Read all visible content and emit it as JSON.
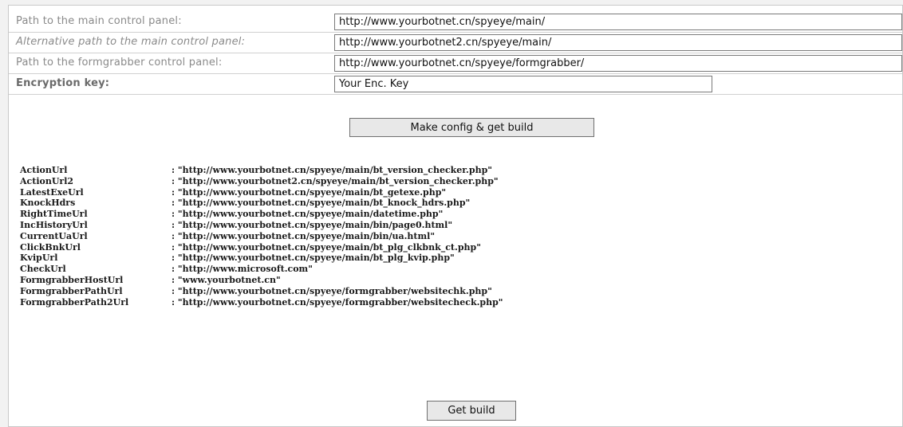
{
  "form": {
    "main_panel": {
      "label": "Path to the main control panel:",
      "value": "http://www.yourbotnet.cn/spyeye/main/"
    },
    "alt_panel": {
      "label": "Alternative path to the main control panel:",
      "value": "http://www.yourbotnet2.cn/spyeye/main/"
    },
    "formgrabber_panel": {
      "label": "Path to the formgrabber control panel:",
      "value": "http://www.yourbotnet.cn/spyeye/formgrabber/"
    },
    "encryption_key": {
      "label": "Encryption key:",
      "value": "Your Enc. Key"
    }
  },
  "buttons": {
    "make_config": "Make config & get build",
    "get_build": "Get build"
  },
  "config": [
    {
      "key": "ActionUrl",
      "value": ": \"http://www.yourbotnet.cn/spyeye/main/bt_version_checker.php\""
    },
    {
      "key": "ActionUrl2",
      "value": ": \"http://www.yourbotnet2.cn/spyeye/main/bt_version_checker.php\""
    },
    {
      "key": "LatestExeUrl",
      "value": ": \"http://www.yourbotnet.cn/spyeye/main/bt_getexe.php\""
    },
    {
      "key": "KnockHdrs",
      "value": ": \"http://www.yourbotnet.cn/spyeye/main/bt_knock_hdrs.php\""
    },
    {
      "key": "RightTimeUrl",
      "value": ": \"http://www.yourbotnet.cn/spyeye/main/datetime.php\""
    },
    {
      "key": "IncHistoryUrl",
      "value": ": \"http://www.yourbotnet.cn/spyeye/main/bin/page0.html\""
    },
    {
      "key": "CurrentUaUrl",
      "value": ": \"http://www.yourbotnet.cn/spyeye/main/bin/ua.html\""
    },
    {
      "key": "ClickBnkUrl",
      "value": ": \"http://www.yourbotnet.cn/spyeye/main/bt_plg_clkbnk_ct.php\""
    },
    {
      "key": "KvipUrl",
      "value": ": \"http://www.yourbotnet.cn/spyeye/main/bt_plg_kvip.php\""
    },
    {
      "key": "CheckUrl",
      "value": ": \"http://www.microsoft.com\""
    },
    {
      "key": "FormgrabberHostUrl",
      "value": ": \"www.yourbotnet.cn\""
    },
    {
      "key": "FormgrabberPathUrl",
      "value": ": \"http://www.yourbotnet.cn/spyeye/formgrabber/websitechk.php\""
    },
    {
      "key": "FormgrabberPath2Url",
      "value": ": \"http://www.yourbotnet.cn/spyeye/formgrabber/websitecheck.php\""
    }
  ]
}
